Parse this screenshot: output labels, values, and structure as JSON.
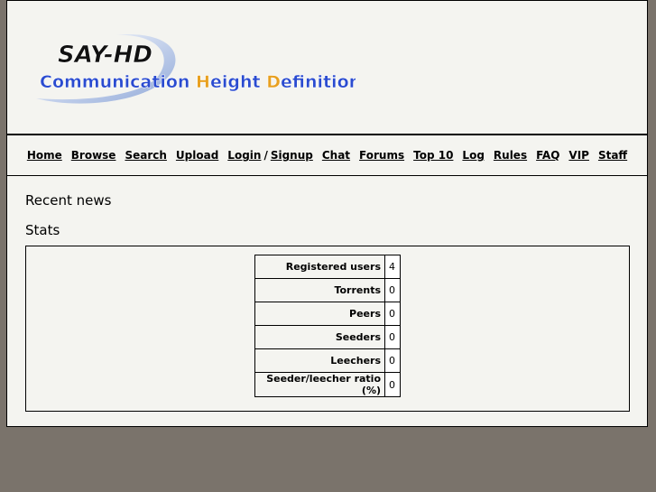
{
  "logo": {
    "line1": "SAY-HD",
    "line2_parts": [
      {
        "text": "Communication ",
        "color": "#2a4bd0"
      },
      {
        "text": "H",
        "color": "#e8a020"
      },
      {
        "text": "eight ",
        "color": "#2a4bd0"
      },
      {
        "text": "D",
        "color": "#e8a020"
      },
      {
        "text": "efinition",
        "color": "#2a4bd0"
      }
    ]
  },
  "nav": {
    "items": [
      {
        "label": "Home"
      },
      {
        "label": "Browse"
      },
      {
        "label": "Search"
      },
      {
        "label": "Upload"
      }
    ],
    "login": "Login",
    "separator": "/",
    "signup": "Signup",
    "items_after": [
      {
        "label": "Chat"
      },
      {
        "label": "Forums"
      },
      {
        "label": "Top 10"
      },
      {
        "label": "Log"
      },
      {
        "label": "Rules"
      },
      {
        "label": "FAQ"
      },
      {
        "label": "VIP"
      },
      {
        "label": "Staff"
      }
    ]
  },
  "sections": {
    "news_title": "Recent news",
    "stats_title": "Stats"
  },
  "stats": {
    "rows": [
      {
        "label": "Registered users",
        "value": "4"
      },
      {
        "label": "Torrents",
        "value": "0"
      },
      {
        "label": "Peers",
        "value": "0"
      },
      {
        "label": "Seeders",
        "value": "0"
      },
      {
        "label": "Leechers",
        "value": "0"
      },
      {
        "label": "Seeder/leecher ratio (%)",
        "value": "0"
      }
    ]
  },
  "colors": {
    "page_background": "#f4f4f0",
    "outer_background": "#7a736b"
  }
}
